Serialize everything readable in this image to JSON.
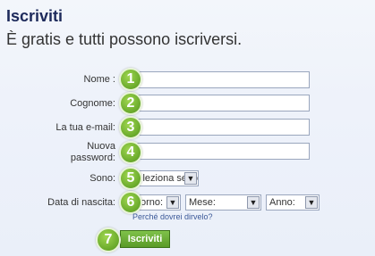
{
  "header": {
    "title": "Iscriviti",
    "subtitle": "È gratis e tutti possono iscriversi."
  },
  "form": {
    "nome_label": "Nome :",
    "cognome_label": "Cognome:",
    "email_label": "La tua e-mail:",
    "password_label_line1": "Nuova",
    "password_label_line2": "password:",
    "sesso_label": "Sono:",
    "sesso_select": "Seleziona sesso:",
    "nascita_label": "Data di nascita:",
    "giorno_select": "Giorno:",
    "mese_select": "Mese:",
    "anno_select": "Anno:",
    "why_link": "Perché dovrei dirvelo?",
    "submit_label": "Iscriviti"
  },
  "badges": [
    "1",
    "2",
    "3",
    "4",
    "5",
    "6",
    "7"
  ],
  "colors": {
    "title": "#1d2a5b",
    "badge": "#69a92b",
    "link": "#3b5998",
    "button": "#5a9a28"
  }
}
